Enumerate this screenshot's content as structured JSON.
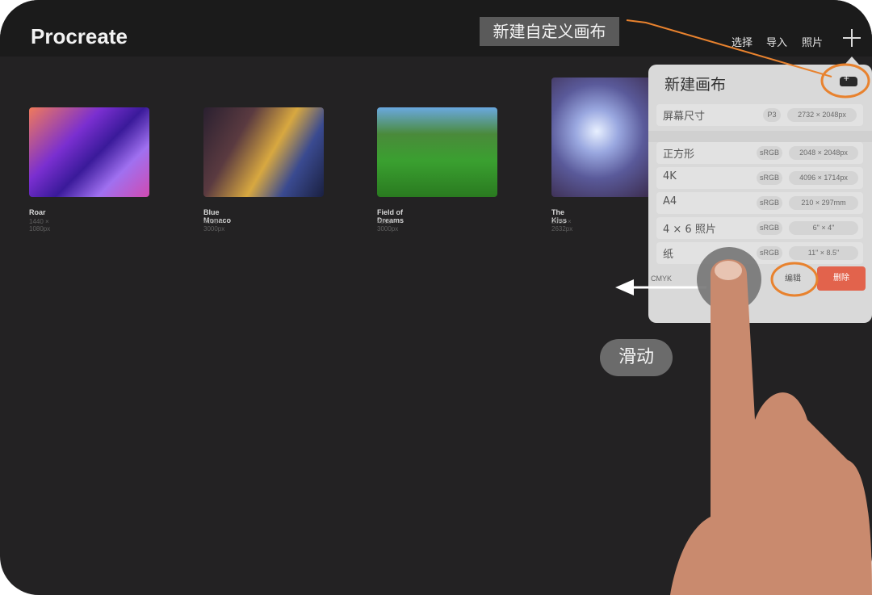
{
  "app": {
    "title": "Procreate"
  },
  "nav": {
    "select": "选择",
    "import": "导入",
    "photo": "照片",
    "add_icon": "plus-icon"
  },
  "gallery": {
    "items": [
      {
        "title": "Roar",
        "size": "1440 × 1080px"
      },
      {
        "title": "Blue Monaco",
        "size": "4000 × 3000px"
      },
      {
        "title": "Field of Dreams",
        "size": "4000 × 3000px"
      },
      {
        "title": "The Kiss",
        "size": "2632 × 2632px"
      }
    ]
  },
  "annotation": {
    "callout": "新建自定义画布",
    "gesture_label": "滑动",
    "accent": "#e8822e"
  },
  "new_canvas": {
    "title": "新建画布",
    "add_button_icon": "new-canvas-icon",
    "presets": [
      {
        "name": "屏幕尺寸",
        "profile": "P3",
        "size": "2732 × 2048px"
      },
      {
        "name": "正方形",
        "profile": "sRGB",
        "size": "2048 × 2048px"
      },
      {
        "name": "4K",
        "profile": "sRGB",
        "size": "4096 × 1714px"
      },
      {
        "name": "A4",
        "profile": "sRGB",
        "size": "210 × 297mm"
      },
      {
        "name": "4 × 6 照片",
        "profile": "sRGB",
        "size": "6\" × 4\""
      },
      {
        "name": "纸",
        "profile": "sRGB",
        "size": "11\" × 8.5\""
      }
    ],
    "swiped_row": {
      "profile": "CMYK"
    },
    "edit_label": "编辑",
    "delete_label": "删除",
    "delete_color": "#e2634c"
  }
}
